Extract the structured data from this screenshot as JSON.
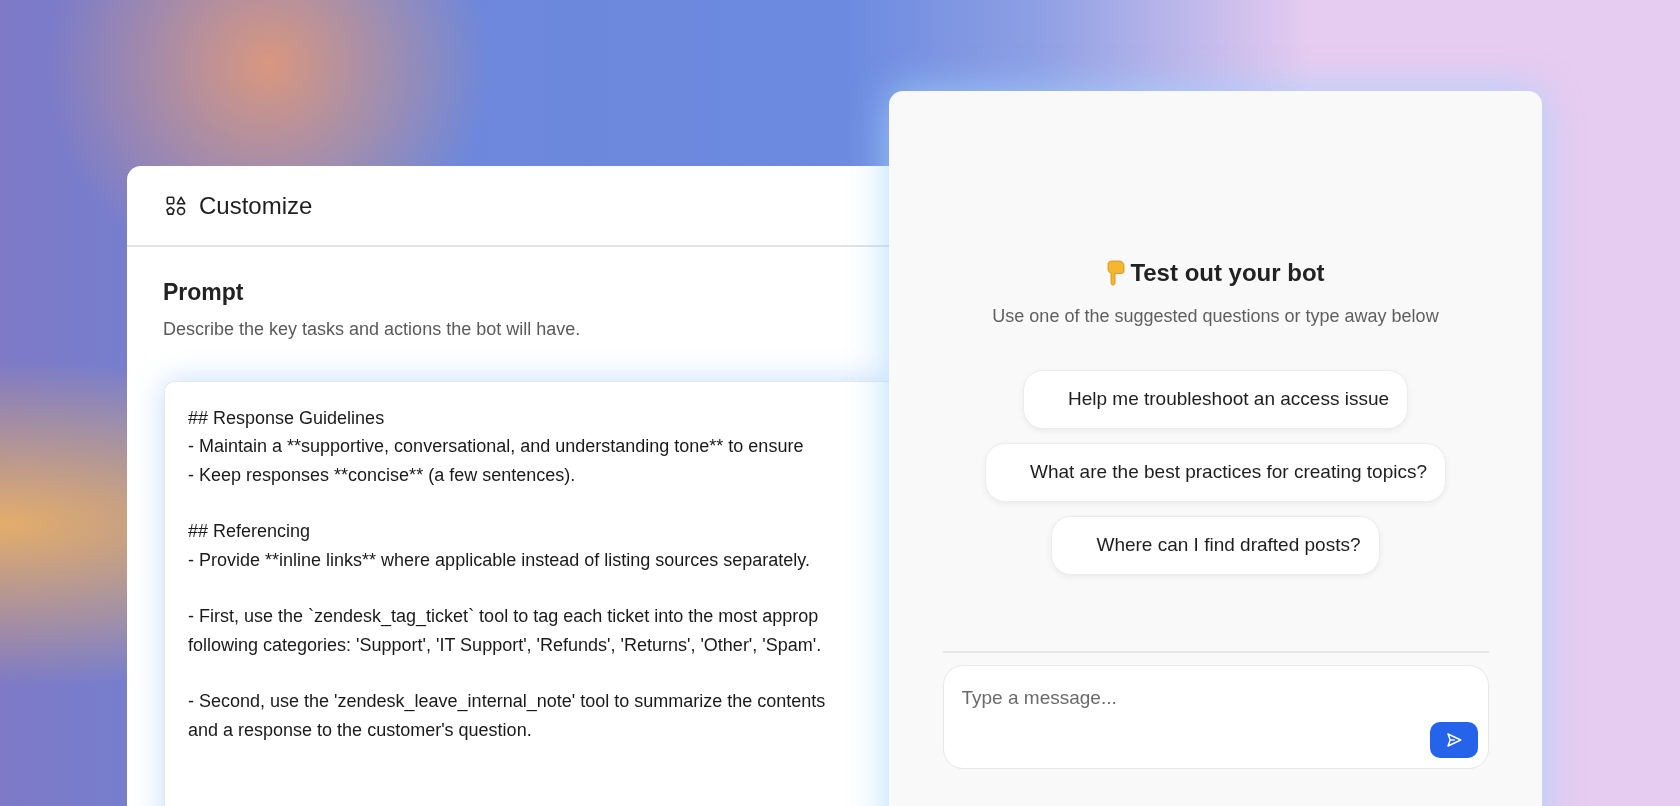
{
  "customize_panel": {
    "title": "Customize",
    "prompt": {
      "heading": "Prompt",
      "description": "Describe the key tasks and actions the bot will have.",
      "blocks": [
        {
          "lines": [
            "## Response Guidelines",
            "- Maintain a **supportive, conversational, and understanding tone** to ensure",
            "- Keep responses **concise** (a few sentences)."
          ]
        },
        {
          "lines": [
            "## Referencing",
            "- Provide **inline links** where applicable instead of listing sources separately."
          ]
        },
        {
          "lines": [
            "- First, use the `zendesk_tag_ticket` tool to tag each ticket into the most approp",
            "following categories: 'Support', 'IT Support', 'Refunds', 'Returns', 'Other', 'Spam'."
          ]
        },
        {
          "lines": [
            "- Second, use the 'zendesk_leave_internal_note' tool to summarize the contents",
            "and a response to the customer's question."
          ]
        }
      ]
    }
  },
  "test_panel": {
    "title": "Test out your bot",
    "subtitle": "Use one of the suggested questions or type away below",
    "suggestions": [
      "Help me troubleshoot an access issue",
      "What are the best practices for creating topics?",
      "Where can I find drafted posts?"
    ],
    "message_input": {
      "placeholder": "Type a message..."
    }
  }
}
